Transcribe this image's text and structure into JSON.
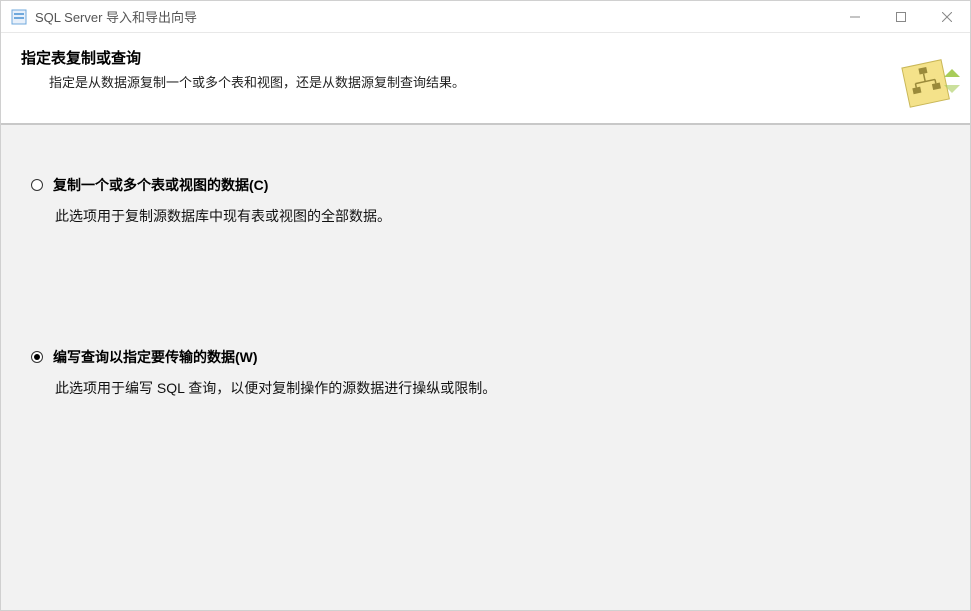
{
  "window": {
    "title": "SQL Server 导入和导出向导"
  },
  "header": {
    "title": "指定表复制或查询",
    "description": "指定是从数据源复制一个或多个表和视图，还是从数据源复制查询结果。"
  },
  "options": {
    "copy": {
      "label": "复制一个或多个表或视图的数据(C)",
      "description": "此选项用于复制源数据库中现有表或视图的全部数据。",
      "selected": false
    },
    "query": {
      "label": "编写查询以指定要传输的数据(W)",
      "description": "此选项用于编写 SQL 查询，以便对复制操作的源数据进行操纵或限制。",
      "selected": true
    }
  }
}
